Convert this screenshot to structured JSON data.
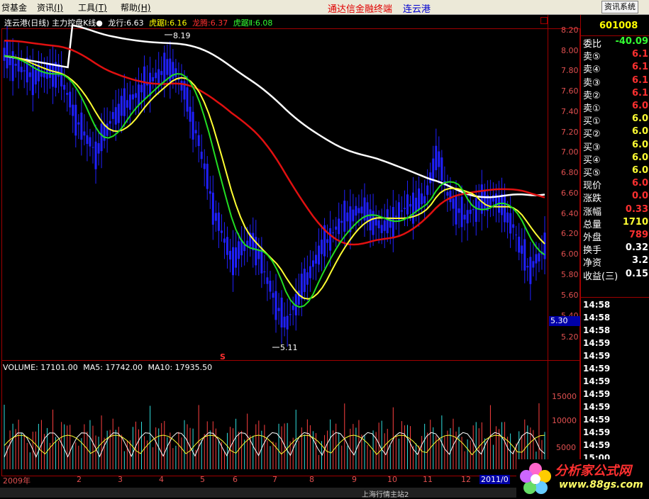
{
  "menu": {
    "items": [
      {
        "label": "贷基金"
      },
      {
        "label": "资讯",
        "key": "(I)"
      },
      {
        "label": "工具",
        "key": "(T)"
      },
      {
        "label": "帮助",
        "key": "(H)"
      }
    ],
    "brand": "通达信金融终端",
    "stock_name": "连云港",
    "news_button": "资讯系统"
  },
  "chart": {
    "title": "连云港(日线) 主力控盘K线●",
    "indicators": [
      {
        "name": "龙行:",
        "value": "6.63",
        "color": "#ffffff"
      },
      {
        "name": "虎踞Ⅰ:",
        "value": "6.16",
        "color": "#ffff00"
      },
      {
        "name": "龙腾:",
        "value": "6.37",
        "color": "#ff3030"
      },
      {
        "name": "虎踞Ⅱ:",
        "value": "6.08",
        "color": "#33ff33"
      }
    ],
    "price_axis": [
      "8.20",
      "8.00",
      "7.80",
      "7.60",
      "7.40",
      "7.20",
      "7.00",
      "6.80",
      "6.60",
      "6.40",
      "6.20",
      "6.00",
      "5.80",
      "5.60",
      "5.40",
      "5.20"
    ],
    "high_label": "8.19",
    "low_label": "5.11",
    "current_price": "5.30",
    "marker": "S",
    "volume_header": {
      "vol": "VOLUME: 17101.00",
      "ma5": "MA5: 17742.00",
      "ma10": "MA10: 17935.50"
    },
    "volume_axis": [
      "15000",
      "10000",
      "5000"
    ],
    "months": [
      "2009年",
      "2",
      "3",
      "4",
      "5",
      "6",
      "7",
      "8",
      "9",
      "10",
      "11",
      "12",
      "2011/0"
    ],
    "colors": {
      "candle": "#2020ff",
      "ma_white": "#ffffff",
      "ma_red": "#e01010",
      "ma_yellow": "#ffff33",
      "ma_green": "#22dd22",
      "frame": "#a00000"
    }
  },
  "quote": {
    "code": "601008",
    "rows": [
      {
        "label": "委比",
        "value": "-40.09",
        "color": "#33ff33"
      },
      {
        "label": "卖⑤",
        "value": "6.1",
        "color": "#ff3030"
      },
      {
        "label": "卖④",
        "value": "6.1",
        "color": "#ff3030"
      },
      {
        "label": "卖③",
        "value": "6.1",
        "color": "#ff3030"
      },
      {
        "label": "卖②",
        "value": "6.1",
        "color": "#ff3030"
      },
      {
        "label": "卖①",
        "value": "6.0",
        "color": "#ff3030"
      },
      {
        "label": "买①",
        "value": "6.0",
        "color": "#ffff33"
      },
      {
        "label": "买②",
        "value": "6.0",
        "color": "#ffff33"
      },
      {
        "label": "买③",
        "value": "6.0",
        "color": "#ffff33"
      },
      {
        "label": "买④",
        "value": "6.0",
        "color": "#ffff33"
      },
      {
        "label": "买⑤",
        "value": "6.0",
        "color": "#ffff33"
      },
      {
        "label": "现价",
        "value": "6.0",
        "color": "#ff3030"
      },
      {
        "label": "涨跌",
        "value": "0.0",
        "color": "#ff3030"
      },
      {
        "label": "涨幅",
        "value": "0.33",
        "color": "#ff3030"
      },
      {
        "label": "总量",
        "value": "1710",
        "color": "#ffff33"
      },
      {
        "label": "外盘",
        "value": "789",
        "color": "#ff3030"
      },
      {
        "label": "换手",
        "value": "0.32",
        "color": "#ffffff"
      },
      {
        "label": "净资",
        "value": "3.2",
        "color": "#ffffff"
      },
      {
        "label": "收益(三)",
        "value": "0.15",
        "color": "#ffffff"
      }
    ],
    "times": [
      "14:58",
      "14:58",
      "14:58",
      "14:59",
      "14:59",
      "14:59",
      "14:59",
      "14:59",
      "14:59",
      "14:59",
      "14:59",
      "14:59",
      "15:00",
      "15:00"
    ]
  },
  "logo": {
    "title": "分析家公式网",
    "url": "www.88gs.com"
  },
  "status_bar": {
    "text": "上海行情主站2"
  }
}
